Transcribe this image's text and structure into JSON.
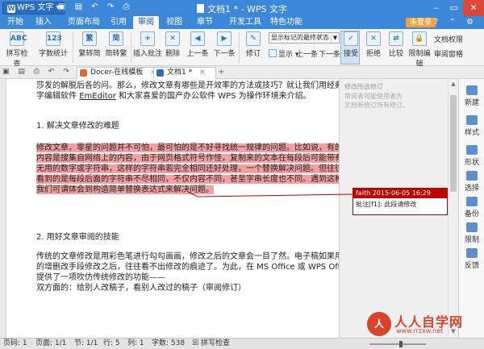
{
  "window": {
    "app_button": "WPS 文字",
    "title": "文档1 * - WPS 文字",
    "qa_icons": "▣ ▤ ↶ ↷ ⎙",
    "minimize": "–",
    "restore": "▭",
    "close": "✕"
  },
  "menu": {
    "tabs": [
      "开始",
      "插入",
      "页面布局",
      "引用",
      "审阅",
      "视图",
      "章节",
      "开发工具",
      "特色功能"
    ],
    "active_tab": "审阅",
    "unregistered": "未登录",
    "right_icons": "? ⌃ ⚙"
  },
  "ribbon": {
    "spellcheck": "拼写检查",
    "wordcount": "字数统计",
    "trad_to_simp": "繁转简",
    "simp_to_trad": "简转繁",
    "insert_comment": "插入批注",
    "delete": "删除",
    "prev_comment": "上一条",
    "next_comment": "下一条",
    "track_changes": "修订",
    "display_select": "显示标记的最终状态",
    "display": "显示",
    "prev_change": "上一条",
    "next_change": "下一条",
    "accept": "接受",
    "reject": "拒绝",
    "compare": "比较",
    "restrict_edit": "限制编辑",
    "doc_permission": "文档权限",
    "review_pane": "审阅窗格",
    "icons": {
      "spellcheck": "ABC",
      "wordcount": "123",
      "trad": "繁",
      "simp": "简",
      "insert_comment": "+",
      "delete": "✕",
      "prev": "◀",
      "next": "▶",
      "track": "✎",
      "accept": "✓"
    }
  },
  "toolbar2": {
    "icons": "▣ ▤ ⎙ ↶ ↷ ▾",
    "tabs": [
      {
        "label": "Docer-在线模板",
        "color": "#e0662b"
      },
      {
        "label": "文档1 *",
        "color": "#2a6fbf"
      }
    ],
    "close_mark": "×",
    "new_tab": "+"
  },
  "document": {
    "line1": "莎发的解脱后各的问。那么，修改文章有哪些是开效率的方法或技巧？就让我们用经典的文",
    "line2_a": "字编辑软件 ",
    "line2_link": "EmEditor",
    "line2_b": " 和大家喜爱的国产办公软件 WPS 为操作环境来介绍。",
    "heading1": "1.  解决文章修改的难题",
    "highlighted": [
      "修改文章，零星的问题并不可怕，最可怕的是不好寻找统一规律的问题。比如说，有的文章",
      "内容是搜集自网络上的内容，由于网页格式符号作怪，复制来的文本在每段后可能带有一些",
      "无用的数字或字符串，这样的字符串若完全相同还好处理，一个替换解决问题。但往往我们",
      "看到的是每段后面的字符串不尽相同，不仅内容不同，甚至字串长度也不同。遇到这种情况，",
      "我们可谓体会到构造简单替换表达式来解决问题。"
    ],
    "heading2": "2.  用好文章审阅的技能",
    "para2": [
      "传统的文章修改是用彩色笔进行勾勾画画，修改之后的文章会一目了然。电子稿如果用普通",
      "的增删改手段修改之后，往往看不出修改的痕迹了。为此，在 MS Office 或 WPS Office 中",
      "提供了一项吹仿传统修改的功能——",
      "双方面的：给别人改稿子，看别人改过的稿子（审阅修订）"
    ]
  },
  "comment_pane": {
    "header": "修改所选修订",
    "note": "审阅者可能使用者为\n文档新修订所有修订。"
  },
  "comment": {
    "author_date": "faith 2015-06-05 16:29",
    "body": "批注[f1]: 此段请修改"
  },
  "taskpane": {
    "items": [
      "新建",
      "样式",
      "形状",
      "选择",
      "备份",
      "限制",
      "反馈"
    ],
    "colors": [
      "#4a84c8",
      "#4a84c8",
      "#4a84c8",
      "#4a84c8",
      "#4a84c8",
      "#4a84c8",
      "#4a84c8"
    ]
  },
  "statusbar": {
    "page": "页码: 1",
    "pages": "页面: 1/1",
    "section": "节: 1/1",
    "row": "行: 5",
    "col": "列: 1",
    "wordcount": "字数: 538",
    "spellcheck": "拼写检查",
    "zoom_value": 0.55
  },
  "watermark": {
    "title": "人人自学网",
    "url": "www.rrzxw.net",
    "badge": "人"
  }
}
